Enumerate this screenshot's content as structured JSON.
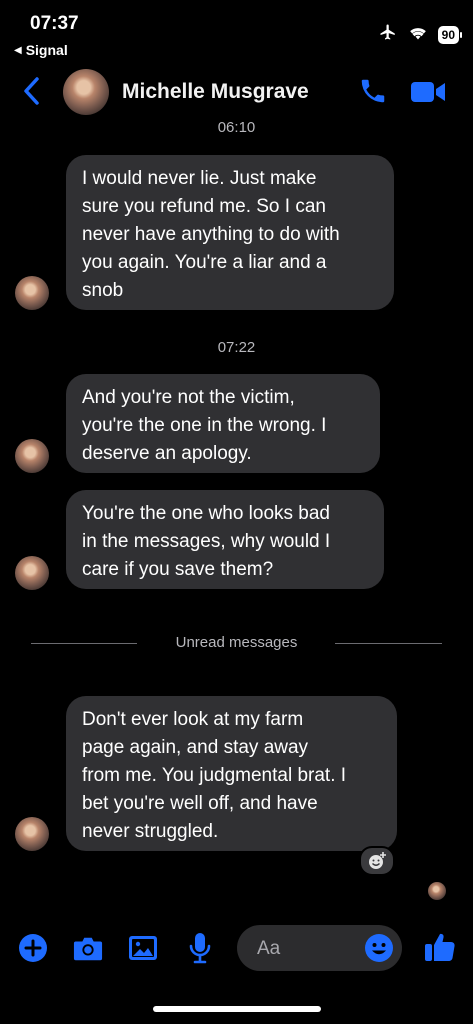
{
  "status_bar": {
    "time": "07:37",
    "back_app": "Signal",
    "battery": "90"
  },
  "header": {
    "contact_name": "Michelle Musgrave",
    "accent_color": "#1e6bff"
  },
  "messages": {
    "time_1": "06:10",
    "msg_1": "I would never lie. Just make\nsure you refund me. So I can\nnever have anything to do with\nyou again. You're a liar and a\nsnob",
    "time_2": "07:22",
    "msg_2": "And you're not the victim,\nyou're the one in the wrong. I\ndeserve an apology.",
    "msg_3": "You're the one who looks bad\nin the messages, why would I\ncare if you save them?",
    "divider": "Unread messages",
    "msg_4": "Don't ever look at my farm\npage again, and stay away\nfrom me. You judgmental brat. I\nbet you're well off, and have\nnever struggled."
  },
  "composer": {
    "placeholder": "Aa",
    "icons": [
      "plus-icon",
      "camera-icon",
      "image-icon",
      "microphone-icon",
      "emoji-icon",
      "thumbs-up-icon"
    ]
  }
}
